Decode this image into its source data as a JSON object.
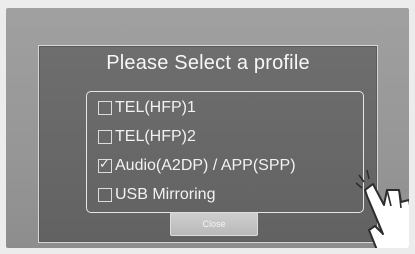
{
  "dialog": {
    "title": "Please Select a profile",
    "options": [
      {
        "label": "TEL(HFP)1",
        "checked": false
      },
      {
        "label": "TEL(HFP)2",
        "checked": false
      },
      {
        "label": "Audio(A2DP) / APP(SPP)",
        "checked": true
      },
      {
        "label": "USB Mirroring",
        "checked": false
      }
    ],
    "close_label": "Close"
  },
  "icons": {
    "checkmark": "✓",
    "pointer": "hand-pointer-icon"
  }
}
